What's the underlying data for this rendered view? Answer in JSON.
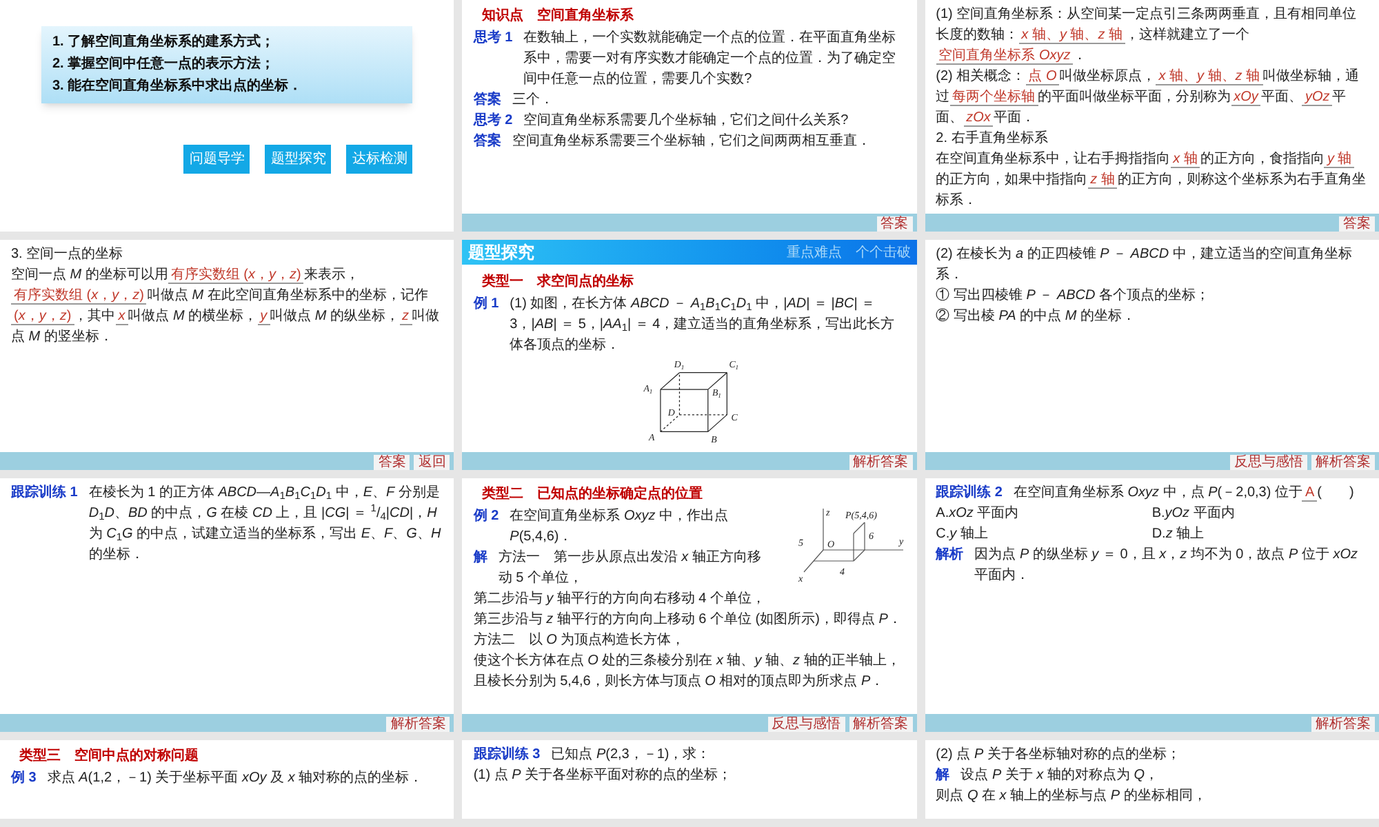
{
  "slides": [
    {
      "blocks": [
        {
          "kind": "objectives",
          "items": [
            "1. 了解空间直角坐标系的建系方式；",
            "2. 掌握空间中任意一点的表示方法；",
            "3. 能在空间直角坐标系中求出点的坐标．"
          ]
        },
        {
          "kind": "nav",
          "buttons": [
            "问题导学",
            "题型探究",
            "达标检测"
          ]
        }
      ]
    },
    {
      "blocks": [
        {
          "kind": "heading",
          "text": "知识点　空间直角坐标系"
        },
        {
          "kind": "para",
          "label": "思考 1",
          "segments": [
            {
              "kind": "plain",
              "text": "在数轴上，一个实数就能确定一个点的位置．在平面直角坐标系中，需要一对有序实数才能确定一个点的位置．为了确定空间中任意一点的位置，需要几个实数?"
            }
          ]
        },
        {
          "kind": "para",
          "label": "答案",
          "segments": [
            {
              "kind": "plain",
              "text": "三个．"
            }
          ]
        },
        {
          "kind": "para",
          "label": "思考 2",
          "segments": [
            {
              "kind": "plain",
              "text": "空间直角坐标系需要几个坐标轴，它们之间什么关系?"
            }
          ]
        },
        {
          "kind": "para",
          "label": "答案",
          "segments": [
            {
              "kind": "plain",
              "text": "空间直角坐标系需要三个坐标轴，它们之间两两相互垂直．"
            }
          ]
        }
      ],
      "footer": [
        "答案"
      ]
    },
    {
      "blocks": [
        {
          "kind": "para",
          "segments": [
            {
              "kind": "plain",
              "text": "(1) 空间直角坐标系：从空间某一定点引三条两两垂直，且有相同单位长度的数轴："
            },
            {
              "kind": "answer",
              "text": "*x* 轴、*y* 轴、*z* 轴"
            },
            {
              "kind": "plain",
              "text": "，这样就建立了一个"
            },
            {
              "kind": "answer",
              "text": "空间直角坐标系 *Oxyz*"
            },
            {
              "kind": "plain",
              "text": "．"
            }
          ]
        },
        {
          "kind": "para",
          "segments": [
            {
              "kind": "plain",
              "text": "(2) 相关概念："
            },
            {
              "kind": "answer",
              "text": "点 *O*"
            },
            {
              "kind": "plain",
              "text": "叫做坐标原点，"
            },
            {
              "kind": "answer",
              "text": "*x* 轴、*y* 轴、*z* 轴"
            },
            {
              "kind": "plain",
              "text": "叫做坐标轴，通过"
            },
            {
              "kind": "answer",
              "text": "每两个坐标轴"
            },
            {
              "kind": "plain",
              "text": "的平面叫做坐标平面，分别称为"
            },
            {
              "kind": "answer",
              "text": "*xOy*"
            },
            {
              "kind": "plain",
              "text": "平面、"
            },
            {
              "kind": "answer",
              "text": "*yOz*"
            },
            {
              "kind": "plain",
              "text": "平面、"
            },
            {
              "kind": "answer",
              "text": "*zOx*"
            },
            {
              "kind": "plain",
              "text": "平面．"
            }
          ]
        },
        {
          "kind": "para",
          "segments": [
            {
              "kind": "plain",
              "text": "2. 右手直角坐标系"
            }
          ]
        },
        {
          "kind": "para",
          "segments": [
            {
              "kind": "plain",
              "text": "在空间直角坐标系中，让右手拇指指向"
            },
            {
              "kind": "answer",
              "text": "*x* 轴"
            },
            {
              "kind": "plain",
              "text": "的正方向，食指指向"
            },
            {
              "kind": "answer",
              "text": "*y* 轴"
            },
            {
              "kind": "plain",
              "text": "的正方向，如果中指指向"
            },
            {
              "kind": "answer",
              "text": "*z* 轴"
            },
            {
              "kind": "plain",
              "text": "的正方向，则称这个坐标系为右手直角坐标系．"
            }
          ]
        }
      ],
      "footer": [
        "答案"
      ]
    },
    {
      "blocks": [
        {
          "kind": "para",
          "segments": [
            {
              "kind": "plain",
              "text": "3. 空间一点的坐标"
            }
          ]
        },
        {
          "kind": "para",
          "segments": [
            {
              "kind": "plain",
              "text": "空间一点 *M* 的坐标可以用"
            },
            {
              "kind": "answer",
              "text": "有序实数组 (*x*，*y*，*z*)"
            },
            {
              "kind": "plain",
              "text": "来表示，"
            },
            {
              "kind": "answer",
              "text": "有序实数组 (*x*，*y*，*z*)"
            },
            {
              "kind": "plain",
              "text": "叫做点 *M* 在此空间直角坐标系中的坐标，记作"
            },
            {
              "kind": "answer",
              "text": "(*x*，*y*，*z*)"
            },
            {
              "kind": "plain",
              "text": "，其中"
            },
            {
              "kind": "answer",
              "text": "*x*"
            },
            {
              "kind": "plain",
              "text": "叫做点 *M* 的横坐标，"
            },
            {
              "kind": "answer",
              "text": "*y*"
            },
            {
              "kind": "plain",
              "text": "叫做点 *M* 的纵坐标，"
            },
            {
              "kind": "answer",
              "text": "*z*"
            },
            {
              "kind": "plain",
              "text": "叫做点 *M* 的竖坐标．"
            }
          ]
        }
      ],
      "footer": [
        "答案",
        "返回"
      ]
    },
    {
      "blocks": [
        {
          "kind": "banner",
          "title": "题型探究",
          "subtitle": "重点难点　个个击破"
        },
        {
          "kind": "heading",
          "text": "类型一　求空间点的坐标"
        },
        {
          "kind": "para",
          "label": "例 1",
          "segments": [
            {
              "kind": "plain",
              "text": "(1) 如图，在长方体 *ABCD* － *A*$_{1}$*B*$_{1}$*C*$_{1}$*D*$_{1}$ 中，|*AD*| ＝ |*BC*| ＝ 3，|*AB*| ＝ 5，|*AA*$_{1}$| ＝ 4，建立适当的直角坐标系，写出此长方体各顶点的坐标．"
            }
          ]
        },
        {
          "kind": "cube_figure",
          "labels": [
            "D$_{1}$",
            "C$_{1}$",
            "A$_{1}$",
            "B$_{1}$",
            "D",
            "C",
            "A",
            "B"
          ]
        }
      ],
      "footer": [
        "解析答案"
      ]
    },
    {
      "blocks": [
        {
          "kind": "para",
          "segments": [
            {
              "kind": "plain",
              "text": "(2) 在棱长为 *a* 的正四棱锥 *P* － *ABCD* 中，建立适当的空间直角坐标系．"
            }
          ]
        },
        {
          "kind": "para",
          "segments": [
            {
              "kind": "plain",
              "text": "① 写出四棱锥 *P* － *ABCD* 各个顶点的坐标；"
            }
          ]
        },
        {
          "kind": "para",
          "segments": [
            {
              "kind": "plain",
              "text": "② 写出棱 *PA* 的中点 *M* 的坐标．"
            }
          ]
        }
      ],
      "footer": [
        "反思与感悟",
        "解析答案"
      ]
    },
    {
      "blocks": [
        {
          "kind": "para",
          "label": "跟踪训练 1",
          "segments": [
            {
              "kind": "plain",
              "text": "在棱长为 1 的正方体 *ABCD*—*A*$_{1}$*B*$_{1}$*C*$_{1}$*D*$_{1}$ 中，*E*、*F* 分别是 *D*$_{1}$*D*、*BD* 的中点，*G* 在棱 *CD* 上，且 |*CG*| ＝ $^{1}$/$_{4}$|*CD*|，*H* 为 *C*$_{1}$*G* 的中点，试建立适当的坐标系，写出 *E*、*F*、*G*、*H* 的坐标．"
            }
          ]
        }
      ],
      "footer": [
        "解析答案"
      ]
    },
    {
      "blocks": [
        {
          "kind": "heading",
          "text": "类型二　已知点的坐标确定点的位置"
        },
        {
          "kind": "row",
          "main": [
            {
              "kind": "para",
              "label": "例 2",
              "segments": [
                {
                  "kind": "plain",
                  "text": "在空间直角坐标系 *Oxyz* 中，作出点 *P*(5,4,6)．"
                }
              ]
            },
            {
              "kind": "para",
              "label": "解",
              "segments": [
                {
                  "kind": "plain",
                  "text": "方法一　第一步从原点出发沿 *x* 轴正方向移动 5 个单位，"
                }
              ]
            }
          ],
          "aside": [
            {
              "kind": "axes_figure",
              "labels": [
                "z",
                "P(5,4,6)",
                "6",
                "5",
                "O",
                "y",
                "x",
                "4"
              ]
            }
          ]
        },
        {
          "kind": "para",
          "segments": [
            {
              "kind": "plain",
              "text": "第二步沿与 *y* 轴平行的方向向右移动 4 个单位，"
            }
          ]
        },
        {
          "kind": "para",
          "segments": [
            {
              "kind": "plain",
              "text": "第三步沿与 *z* 轴平行的方向向上移动 6 个单位 (如图所示)，即得点 *P*．"
            }
          ]
        },
        {
          "kind": "para",
          "segments": [
            {
              "kind": "plain",
              "text": "方法二　以 *O* 为顶点构造长方体，"
            }
          ]
        },
        {
          "kind": "para",
          "segments": [
            {
              "kind": "plain",
              "text": "使这个长方体在点 *O* 处的三条棱分别在 *x* 轴、*y* 轴、*z* 轴的正半轴上，且棱长分别为 5,4,6，则长方体与顶点 *O* 相对的顶点即为所求点 *P*．"
            }
          ]
        }
      ],
      "footer": [
        "反思与感悟",
        "解析答案"
      ]
    },
    {
      "blocks": [
        {
          "kind": "para",
          "label": "跟踪训练 2",
          "segments": [
            {
              "kind": "plain",
              "text": "在空间直角坐标系 *Oxyz* 中，点 *P*(－2,0,3) 位于"
            },
            {
              "kind": "answer",
              "text": "A"
            },
            {
              "kind": "plain",
              "text": "(　　)"
            }
          ]
        },
        {
          "kind": "options",
          "items": [
            "A.*xOz* 平面内",
            "B.*yOz* 平面内",
            "C.*y* 轴上",
            "D.*z* 轴上"
          ]
        },
        {
          "kind": "para",
          "label": "解析",
          "segments": [
            {
              "kind": "plain",
              "text": "因为点 *P* 的纵坐标 *y* ＝ 0，且 *x*，*z* 均不为 0，故点 *P* 位于 *xOz* 平面内．"
            }
          ]
        }
      ],
      "footer": [
        "解析答案"
      ]
    },
    {
      "blocks": [
        {
          "kind": "heading",
          "text": "类型三　空间中点的对称问题"
        },
        {
          "kind": "para",
          "label": "例 3",
          "segments": [
            {
              "kind": "plain",
              "text": "求点 *A*(1,2，－1) 关于坐标平面 *xOy* 及 *x* 轴对称的点的坐标．"
            }
          ]
        }
      ]
    },
    {
      "blocks": [
        {
          "kind": "para",
          "label": "跟踪训练 3",
          "segments": [
            {
              "kind": "plain",
              "text": "已知点 *P*(2,3，－1)，求："
            }
          ]
        },
        {
          "kind": "para",
          "segments": [
            {
              "kind": "plain",
              "text": "(1) 点 *P* 关于各坐标平面对称的点的坐标；"
            }
          ]
        }
      ]
    },
    {
      "blocks": [
        {
          "kind": "para",
          "segments": [
            {
              "kind": "plain",
              "text": "(2) 点 *P* 关于各坐标轴对称的点的坐标；"
            }
          ]
        },
        {
          "kind": "para",
          "label": "解",
          "segments": [
            {
              "kind": "plain",
              "text": "设点 *P* 关于 *x* 轴的对称点为 *Q*，"
            }
          ]
        },
        {
          "kind": "para",
          "segments": [
            {
              "kind": "plain",
              "text": "则点 *Q* 在 *x* 轴上的坐标与点 *P* 的坐标相同，"
            }
          ]
        }
      ]
    }
  ]
}
